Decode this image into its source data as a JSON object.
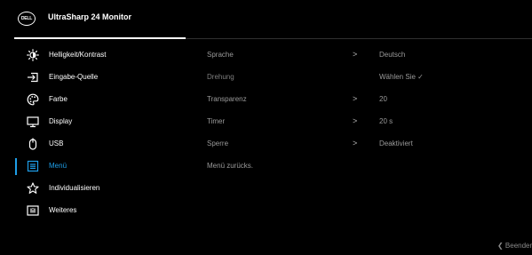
{
  "header": {
    "logo_text": "DELL",
    "title": "UltraSharp 24 Monitor"
  },
  "nav": {
    "items": [
      {
        "label": "Helligkeit/Kontrast",
        "icon": "brightness-icon"
      },
      {
        "label": "Eingabe-Quelle",
        "icon": "input-source-icon"
      },
      {
        "label": "Farbe",
        "icon": "color-palette-icon"
      },
      {
        "label": "Display",
        "icon": "monitor-icon"
      },
      {
        "label": "USB",
        "icon": "mouse-icon"
      },
      {
        "label": "Menü",
        "icon": "menu-icon",
        "active": true
      },
      {
        "label": "Individualisieren",
        "icon": "star-icon"
      },
      {
        "label": "Weiteres",
        "icon": "info-box-icon"
      }
    ]
  },
  "settings": {
    "rows": [
      {
        "label": "Sprache",
        "has_chevron": true,
        "value": "Deutsch"
      },
      {
        "label": "Drehung",
        "has_chevron": false,
        "value": "Wählen Sie ✓"
      },
      {
        "label": "Transparenz",
        "has_chevron": true,
        "value": "20"
      },
      {
        "label": "Timer",
        "has_chevron": true,
        "value": "20 s"
      },
      {
        "label": "Sperre",
        "has_chevron": true,
        "value": "Deaktiviert"
      },
      {
        "label": "Menü zurücks.",
        "has_chevron": false,
        "value": ""
      }
    ],
    "chevron_glyph": ">"
  },
  "footer": {
    "exit_label": "❮ Beenden"
  },
  "colors": {
    "accent": "#1e9ee8",
    "background": "#000000",
    "setting_label": "#9a9a9a"
  }
}
